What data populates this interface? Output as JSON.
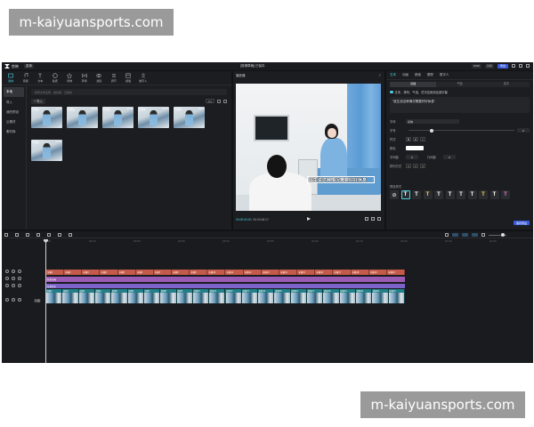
{
  "watermarks": {
    "top": "m-kaiyuansports.com",
    "bottom": "m-kaiyuansports.com"
  },
  "titlebar": {
    "app_name": "剪映",
    "menu_label": "菜单",
    "project_title": "[剪辑草稿] 已保存",
    "pill1": "SVIP",
    "pill2": "分享",
    "export": "导出"
  },
  "tools": [
    {
      "label": "媒体",
      "icon": "media-icon"
    },
    {
      "label": "音频",
      "icon": "audio-icon"
    },
    {
      "label": "文本",
      "icon": "text-icon"
    },
    {
      "label": "贴纸",
      "icon": "sticker-icon"
    },
    {
      "label": "特效",
      "icon": "effect-icon"
    },
    {
      "label": "转场",
      "icon": "transition-icon"
    },
    {
      "label": "滤镜",
      "icon": "filter-icon"
    },
    {
      "label": "调节",
      "icon": "adjust-icon"
    },
    {
      "label": "模板",
      "icon": "template-icon"
    },
    {
      "label": "数字人",
      "icon": "avatar-icon"
    }
  ],
  "side_nav": [
    "本地",
    "导入",
    "我的预设",
    "云素材",
    "素材库"
  ],
  "search": {
    "placeholder": "搜索文件名称、素材库、云素材"
  },
  "import_label": "导入",
  "view_ctl": "排序",
  "clips": [
    {
      "name": "已添加",
      "dur": "00:03"
    },
    {
      "name": "已添加",
      "dur": "00:12"
    },
    {
      "name": "已添加",
      "dur": "00:08"
    },
    {
      "name": "已添加",
      "dur": "00:05"
    },
    {
      "name": "已添加",
      "dur": "00:21"
    },
    {
      "name": "已添加",
      "dur": "00:04"
    }
  ],
  "preview": {
    "title": "播放器",
    "subtitle": "医生说这种情况需要好好休息",
    "time_current": "00:00:00:00",
    "time_total": "00:00:48:17"
  },
  "right_panel": {
    "tabs": [
      "文本",
      "动画",
      "朗读",
      "跟踪",
      "数字人"
    ],
    "subtabs": [
      "基础",
      "气泡",
      "花字"
    ],
    "check_label": "文本、排列、气泡、花字应用到全部字幕",
    "text_value": "\"医生说这种情况需要好好休息\"",
    "font_label": "字体",
    "font_value": "系统",
    "size_label": "字号",
    "size_value": "6",
    "style_label": "样式",
    "color_label": "颜色",
    "spacing_label": "字间距",
    "spacing_value": "0",
    "line_label": "行间距",
    "line_value": "0",
    "align_label": "排列方式",
    "preset_label": "预设样式",
    "apply_label": "保存预设"
  },
  "presets": [
    {
      "glyph": "⊘",
      "color": "#bbbbbb"
    },
    {
      "glyph": "T",
      "color": "#ffffff"
    },
    {
      "glyph": "T",
      "color": "#ffffff"
    },
    {
      "glyph": "T",
      "color": "#f2d44a"
    },
    {
      "glyph": "T",
      "color": "#ffffff"
    },
    {
      "glyph": "T",
      "color": "#ffffff"
    },
    {
      "glyph": "T",
      "color": "#ffffff"
    },
    {
      "glyph": "T",
      "color": "#ffffff"
    },
    {
      "glyph": "T",
      "color": "#f2d44a"
    },
    {
      "glyph": "T",
      "color": "#ffffff"
    },
    {
      "glyph": "T",
      "color": "#e07bd0"
    }
  ],
  "timeline": {
    "ruler": [
      "00:00",
      "|00:10",
      "|00:20",
      "|00:30",
      "|00:40",
      "|00:50",
      "|01:00",
      "|01:10",
      "|01:20",
      "|01:30",
      "|01:40"
    ],
    "cover_label": "封面",
    "text_track": [
      "字幕1",
      "字幕2",
      "字幕3",
      "字幕4",
      "字幕5",
      "字幕6",
      "字幕7",
      "字幕8",
      "字幕9",
      "字幕10",
      "字幕11",
      "字幕12",
      "字幕13",
      "字幕14",
      "字幕15",
      "字幕16",
      "字幕17",
      "字幕18",
      "字幕19",
      "字幕20"
    ],
    "sticker_track": "贴纸动画",
    "audio_track": "背景音乐",
    "video_track": [
      "视频1",
      "视频2",
      "视频3",
      "视频4",
      "视频5",
      "视频6",
      "视频7",
      "视频8",
      "视频9",
      "视频10",
      "视频11",
      "视频12",
      "视频13",
      "视频14",
      "视频15",
      "视频16",
      "视频17",
      "视频18",
      "视频19",
      "视频20",
      "视频21",
      "视频22"
    ]
  }
}
